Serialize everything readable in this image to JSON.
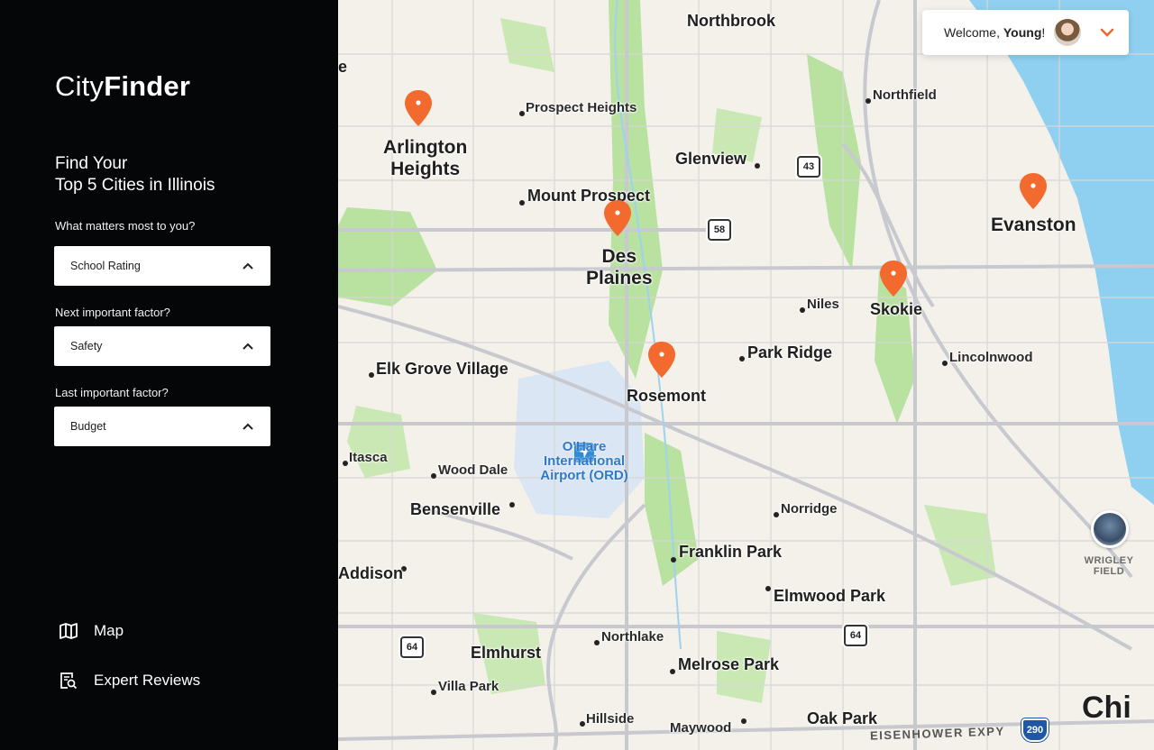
{
  "app": {
    "brand_light": "City",
    "brand_bold": "Finder",
    "heading_line1": "Find Your",
    "heading_line2": "Top 5 Cities in Illinois"
  },
  "questions": [
    {
      "label": "What matters most to you?",
      "value": "School Rating"
    },
    {
      "label": "Next important factor?",
      "value": "Safety"
    },
    {
      "label": "Last important factor?",
      "value": "Budget"
    }
  ],
  "nav": [
    {
      "label": "Map",
      "icon": "map-icon"
    },
    {
      "label": "Expert Reviews",
      "icon": "review-document-icon"
    }
  ],
  "user": {
    "welcome_prefix": "Welcome, ",
    "name": "Young",
    "suffix": "!"
  },
  "map": {
    "places": {
      "northbrook": "Northbrook",
      "northfield": "Northfield",
      "prospect_heights": "Prospect Heights",
      "arlington_1": "Arlington",
      "arlington_2": "Heights",
      "glenview": "Glenview",
      "mount_prospect": "Mount Prospect",
      "evanston": "Evanston",
      "des_plaines_1": "Des",
      "des_plaines_2": "Plaines",
      "niles": "Niles",
      "skokie": "Skokie",
      "park_ridge": "Park Ridge",
      "lincolnwood": "Lincolnwood",
      "elk_grove": "Elk Grove Village",
      "rosemont": "Rosemont",
      "itasca": "Itasca",
      "wood_dale": "Wood Dale",
      "bensenville": "Bensenville",
      "norridge": "Norridge",
      "franklin_park": "Franklin Park",
      "addison": "Addison",
      "elmwood_park": "Elmwood Park",
      "northlake": "Northlake",
      "elmhurst": "Elmhurst",
      "melrose_park": "Melrose Park",
      "villa_park": "Villa Park",
      "hillside": "Hillside",
      "maywood": "Maywood",
      "oak_park": "Oak Park",
      "chicago": "Chi",
      "edge_e": "e"
    },
    "airport_line1": "O'Hare",
    "airport_line2": "International",
    "airport_line3": "Airport (ORD)",
    "landmark_line1": "WRIGLEY",
    "landmark_line2": "FIELD",
    "expressway": "EISENHOWER EXPY",
    "shields": {
      "r43": "43",
      "r58": "58",
      "r64a": "64",
      "r64b": "64",
      "i290": "290"
    },
    "pins": [
      "Arlington Heights",
      "Des Plaines",
      "Rosemont",
      "Skokie",
      "Evanston"
    ],
    "colors": {
      "pin": "#f26a2e",
      "water": "#8fd0f0",
      "park": "#b9e1a0",
      "road": "#c7c9cf"
    }
  }
}
